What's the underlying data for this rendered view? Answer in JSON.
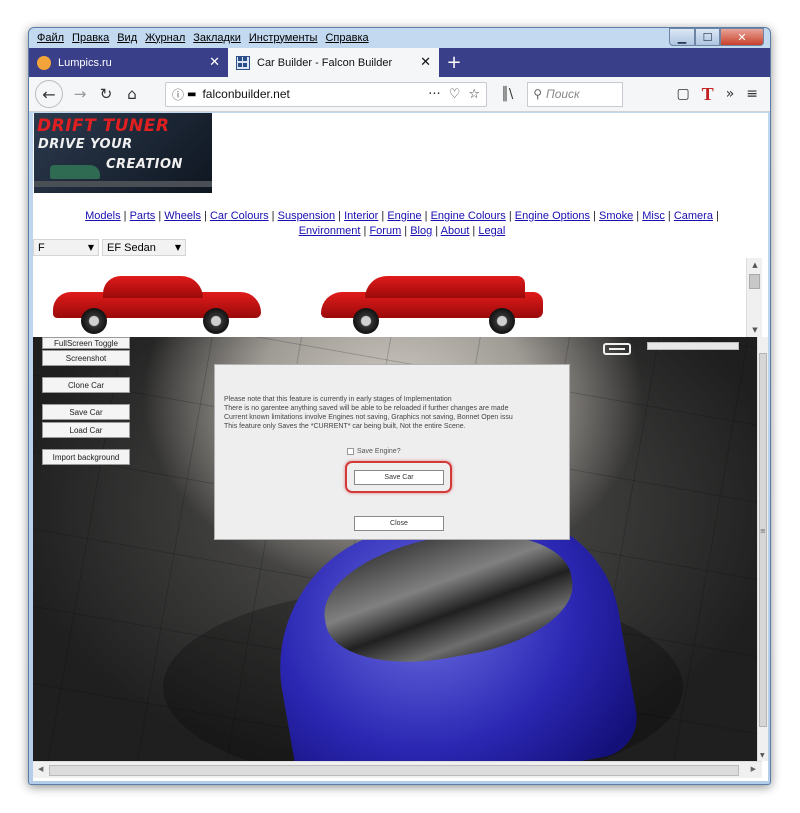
{
  "window": {
    "menu": [
      "Файл",
      "Правка",
      "Вид",
      "Журнал",
      "Закладки",
      "Инструменты",
      "Справка"
    ]
  },
  "tabs": [
    {
      "title": "Lumpics.ru"
    },
    {
      "title": "Car Builder - Falcon Builder"
    }
  ],
  "navbar": {
    "url": "falconbuilder.net",
    "search_placeholder": "Поиск"
  },
  "logo": {
    "line1": "DRIFT TUNER",
    "line2": "DRIVE YOUR",
    "line3": "CREATION"
  },
  "site_nav": {
    "row1": [
      "Models",
      "Parts",
      "Wheels",
      "Car Colours",
      "Suspension",
      "Interior",
      "Engine",
      "Engine Colours",
      "Engine Options",
      "Smoke",
      "Misc",
      "Camera"
    ],
    "row2": [
      "Environment",
      "Forum",
      "Blog",
      "About",
      "Legal"
    ]
  },
  "selectors": {
    "make": "F",
    "model": "EF Sedan"
  },
  "viewport_buttons": {
    "fullscreen": "FullScreen Toggle",
    "screenshot": "Screenshot",
    "clone": "Clone Car",
    "save": "Save Car",
    "load": "Load Car",
    "import_bg": "Import background"
  },
  "dialog": {
    "lines": [
      "Please note that this feature is currently in early stages of Implementation",
      "There is no garentee anything saved will be able to be reloaded if further changes are made",
      "Current known limitations involve Engines not saving, Graphics not saving, Bonnet Open issu",
      "This feature only Saves the *CURRENT* car being built, Not the entire Scene."
    ],
    "save_engine_label": "Save Engine?",
    "save_engine_checked": false,
    "save_button": "Save Car",
    "close_button": "Close"
  },
  "colors": {
    "tabstrip": "#3a3f8a",
    "link": "#1a0fb0",
    "highlight": "#d23a3a",
    "car_red": "#d01515",
    "car_blue": "#2b27b3"
  }
}
